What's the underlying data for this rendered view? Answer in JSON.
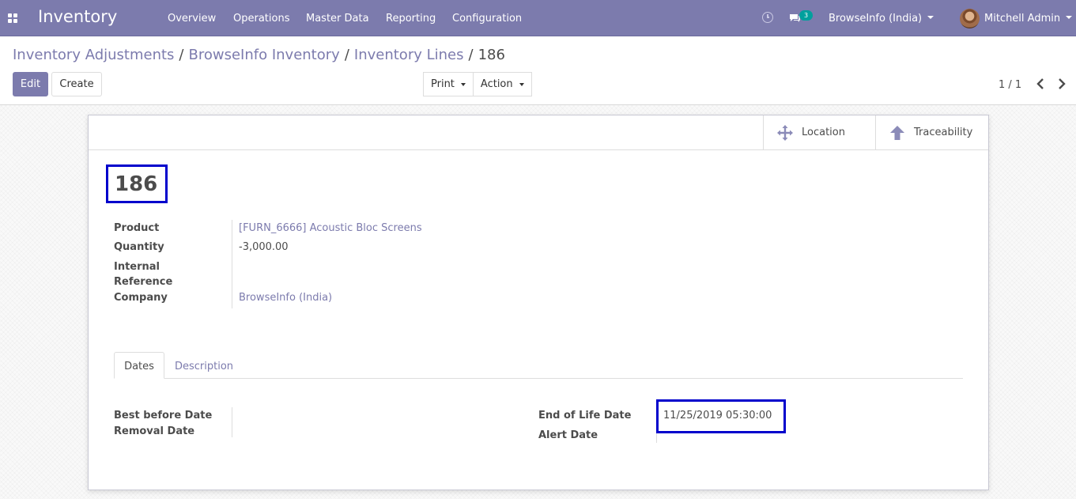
{
  "navbar": {
    "app_title": "Inventory",
    "menu": [
      "Overview",
      "Operations",
      "Master Data",
      "Reporting",
      "Configuration"
    ],
    "chat_badge": "3",
    "company": "BrowseInfo (India)",
    "user": "Mitchell Admin",
    "bg_color": "#7c7bad"
  },
  "breadcrumb": {
    "items": [
      "Inventory Adjustments",
      "BrowseInfo Inventory",
      "Inventory Lines"
    ],
    "current": "186",
    "separator": "/"
  },
  "toolbar": {
    "edit_label": "Edit",
    "create_label": "Create",
    "print_label": "Print",
    "action_label": "Action"
  },
  "pager": {
    "text": "1 / 1"
  },
  "smart_buttons": [
    {
      "label": "Location",
      "icon": "arrows-move-icon"
    },
    {
      "label": "Traceability",
      "icon": "arrow-up-icon"
    }
  ],
  "record": {
    "title": "186",
    "fields": {
      "product_label": "Product",
      "product_value": "[FURN_6666] Acoustic Bloc Screens",
      "quantity_label": "Quantity",
      "quantity_value": "-3,000.00",
      "internal_ref_label_1": "Internal",
      "internal_ref_label_2": "Reference",
      "company_label": "Company",
      "company_value": "BrowseInfo (India)"
    }
  },
  "tabs": {
    "active": "Dates",
    "other": "Description"
  },
  "dates": {
    "best_before_label": "Best before Date",
    "removal_label": "Removal Date",
    "end_of_life_label": "End of Life Date",
    "end_of_life_value": "11/25/2019 05:30:00",
    "alert_label": "Alert Date"
  },
  "colors": {
    "accent": "#7c7bad",
    "highlight": "#0000cc",
    "badge": "#00a09d"
  }
}
